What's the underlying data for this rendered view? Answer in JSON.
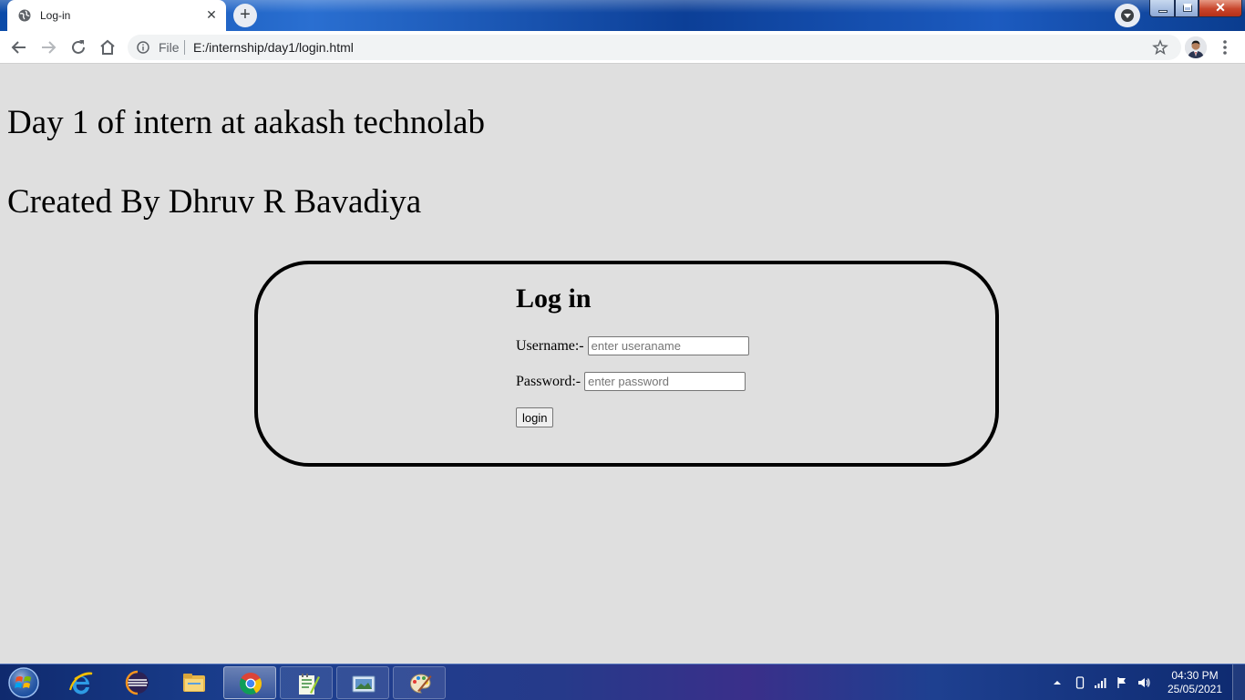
{
  "browser": {
    "tab": {
      "title": "Log-in",
      "close_glyph": "✕",
      "favicon": "globe-icon"
    },
    "new_tab_glyph": "+",
    "omnibox": {
      "scheme_label": "File",
      "url": "E:/internship/day1/login.html"
    },
    "window_controls": {
      "close_glyph": "✕"
    }
  },
  "page": {
    "heading_1": "Day 1 of intern at aakash technolab",
    "heading_2": "Created By Dhruv R Bavadiya",
    "login": {
      "title": "Log in",
      "username_label": "Username:-",
      "username_placeholder": "enter useraname",
      "username_value": "",
      "password_label": "Password:-",
      "password_placeholder": "enter password",
      "password_value": "",
      "button_label": "login"
    }
  },
  "taskbar": {
    "apps": [
      "internet-explorer",
      "eclipse",
      "windows-explorer",
      "chrome",
      "notepad-plus-plus",
      "photo-viewer",
      "paint"
    ],
    "clock": {
      "time": "04:30 PM",
      "date": "25/05/2021"
    }
  },
  "colors": {
    "page_background": "#dfdfdf",
    "login_border": "#000000",
    "taskbar": "#1b3f8f"
  }
}
